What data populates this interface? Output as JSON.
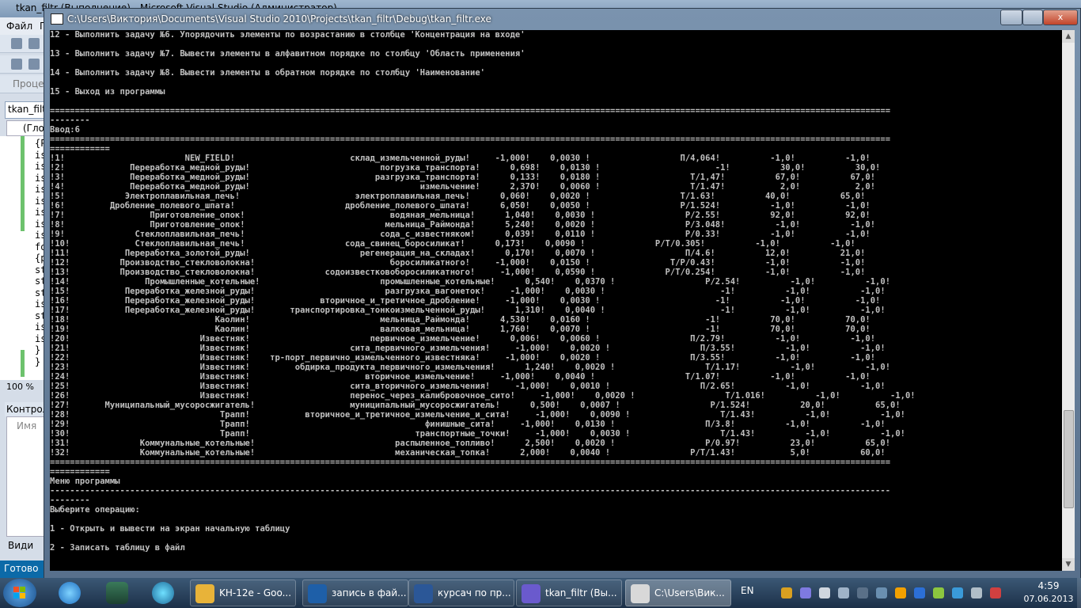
{
  "vs": {
    "title": "tkan_filtr (Выполнение) - Microsoft Visual Studio (Администратор)",
    "menu_file": "Файл",
    "menu_more": "П",
    "process_label": "Процесс",
    "doc_tab": "tkan_filtr",
    "scope": "(Глоб",
    "code_lines": [
      "{P",
      "is",
      "is",
      "is",
      "is",
      "is",
      "is",
      "is",
      "is",
      "fo",
      "{p",
      "st",
      "st",
      "st",
      "is",
      "st",
      "is",
      "is",
      "}",
      "}"
    ],
    "zoom": "100 %",
    "panel_title": "Контрол",
    "panel_col": "Имя",
    "view_label": "Види",
    "status": "Готово"
  },
  "console": {
    "title": "C:\\Users\\Виктория\\Documents\\Visual Studio 2010\\Projects\\tkan_filtr\\Debug\\tkan_filtr.exe",
    "minimize": "",
    "maximize": "",
    "close": "x",
    "lines": [
      "12 - Выполнить задачу №6. Упорядочить элементы по возрастанию в столбце 'Концентрация на входе'",
      "",
      "13 - Выполнить задачу №7. Вывести элементы в алфавитном порядке по столбцу 'Область применения'",
      "",
      "14 - Выполнить задачу №8. Вывести элементы в обратном порядке по столбцу 'Наименование'",
      "",
      "15 - Выход из программы",
      "",
      "========================================================================================================================================================================",
      "--------",
      "Ввод:6",
      "========================================================================================================================================================================",
      "============",
      "!1!                        NEW_FIELD!                       склад_измельченной_руды!     -1,000!    0,0030 !                  П/4,064!          -1,0!          -1,0!",
      "!2!             Переработка_медной_руды!                          погрузка_транспорта!      0,698!    0,0130 !                       -1!          30,0!          30,0!",
      "!3!             Переработка_медной_руды!                         разгрузка_транспорта!      0,133!    0,0180 !                  Т/1,47!          67,0!          67,0!",
      "!4!             Переработка_медной_руды!                                  измельчение!      2,370!    0,0060 !                  Т/1.47!           2,0!           2,0!",
      "!5!            Электроплавильная_печь!                       электроплавильная_печь!      0,060!    0,0020 !                  Т/1.63!          40,0!          65,0!",
      "!6!         Дробление_полевого_шпата!                      дробление_полевого_шпата!      6,050!    0,0050 !                  Р/1.524!          -1,0!          -1,0!",
      "!7!                 Приготовление_опок!                             водяная_мельница!      1,040!    0,0030 !                  Р/2.55!          92,0!          92,0!",
      "!8!                 Приготовление_опок!                            мельница_Раймонда!      5,240!    0,0020 !                  Р/3.048!          -1,0!          -1,0!",
      "!9!              Стеклоплавильная_печь!                           сода_с_известняком!      0,039!    0,0110 !                  Р/0.33!          -1,0!          -1,0!",
      "!10!             Стеклоплавильная_печь!                    сода_свинец_боросиликат!      0,173!    0,0090 !              Р/Т/0.305!          -1,0!          -1,0!",
      "!11!           Переработка_золотой_руды!                      регенерация_на_складах!      0,170!    0,0070 !                  П/4.6!          12,0!          21,0!",
      "!12!          Производство_стекловолокна!                           боросиликатного!     -1,000!    0,0150 !                Т/Р/0.43!          -1,0!          -1,0!",
      "!13!          Производство_стекловолокна!              содоизвестковоборосиликатного!     -1,000!    0,0590 !              Р/Т/0.254!          -1,0!          -1,0!",
      "!14!               Промышленные_котельные!                        промышленные_котельные!      0,540!    0,0370 !                  Р/2.54!          -1,0!          -1,0!",
      "!15!           Переработка_железной_руды!                          разгрузка_вагонеток!     -1,000!    0,0030 !                       -1!          -1,0!          -1,0!",
      "!16!           Переработка_железной_руды!             вторичное_и_третичное_дробление!     -1,000!    0,0030 !                       -1!          -1,0!          -1,0!",
      "!17!           Переработка_железной_руды!       транспортировка_тонкоизмельченной_руды!      1,310!    0,0040 !                       -1!          -1,0!          -1,0!",
      "!18!                             Каолин!                          мельница_Раймонда!      4,530!    0,0160 !                       -1!          70,0!          70,0!",
      "!19!                             Каолин!                          валковая_мельница!      1,760!    0,0070 !                       -1!          70,0!          70,0!",
      "!20!                          Известняк!                        первичное_измельчение!      0,006!    0,0060 !                  П/2.79!          -1,0!          -1,0!",
      "!21!                          Известняк!                    сита_первичного_измельчения!     -1,000!    0,0020 !                  П/3.55!          -1,0!          -1,0!",
      "!22!                          Известняк!    тр-порт_первично_измельченного_известняка!     -1,000!    0,0020 !                  П/3.55!          -1,0!          -1,0!",
      "!23!                          Известняк!         обдирка_продукта_первичного_измельчения!      1,240!    0,0020 !                  Т/1.17!          -1,0!          -1,0!",
      "!24!                          Известняк!                       вторичное_измельчение!     -1,000!    0,0040 !                  Т/1.07!          -1,0!          -1,0!",
      "!25!                          Известняк!                    сита_вторичного_измельчения!     -1,000!    0,0010 !                  П/2.65!          -1,0!          -1,0!",
      "!26!                          Известняк!                    перенос_через_калибровочное_сито!     -1,000!    0,0020 !                  Т/1.016!          -1,0!          -1,0!",
      "!27!       Муниципальный_мусоросжигатель!                   муниципальный_мусоросжигатель!      0,500!    0,0007 !                  Р/1.524!          20,0!          65,0!",
      "!28!                              Трапп!           вторичное_и_третичное_измельчение_и_сита!     -1,000!    0,0090 !                  Т/1.43!          -1,0!          -1,0!",
      "!29!                              Трапп!                                   финишные_сита!     -1,000!    0,0130 !                  П/3.8!          -1,0!          -1,0!",
      "!30!                              Трапп!                                 транспортные_точки!     -1,000!    0,0030 !                  Т/1.43!          -1,0!          -1,0!",
      "!31!              Коммунальные_котельные!                            распыленное_топливо!      2,500!    0,0020 !                  Р/0.97!          23,0!          65,0!",
      "!32!              Коммунальные_котельные!                            механическая_топка!      2,000!    0,0040 !                Р/Т/1.43!           5,0!          60,0!",
      "========================================================================================================================================================================",
      "============",
      "Меню программы",
      "------------------------------------------------------------------------------------------------------------------------------------------------------------------------",
      "--------",
      "Выберите операцию:",
      "",
      "1 - Открыть и вывести на экран начальную таблицу",
      "",
      "2 - Записать таблицу в файл"
    ]
  },
  "taskbar": {
    "tasks": [
      {
        "label": "KH-12e - Goo...",
        "color": "#e8b339"
      },
      {
        "label": "запись в фай...",
        "color": "#1e5fa8"
      },
      {
        "label": "курсач по пр...",
        "color": "#2b5797"
      },
      {
        "label": "tkan_filtr (Вы...",
        "color": "#6a5acd"
      },
      {
        "label": "C:\\Users\\Вик...",
        "color": "#d8d8d8"
      }
    ],
    "lang": "EN",
    "time": "4:59",
    "date": "07.06.2013"
  },
  "colors": {
    "console_bg": "#000000",
    "console_text": "#c0c0c0",
    "taskbar": "#1c3048"
  }
}
